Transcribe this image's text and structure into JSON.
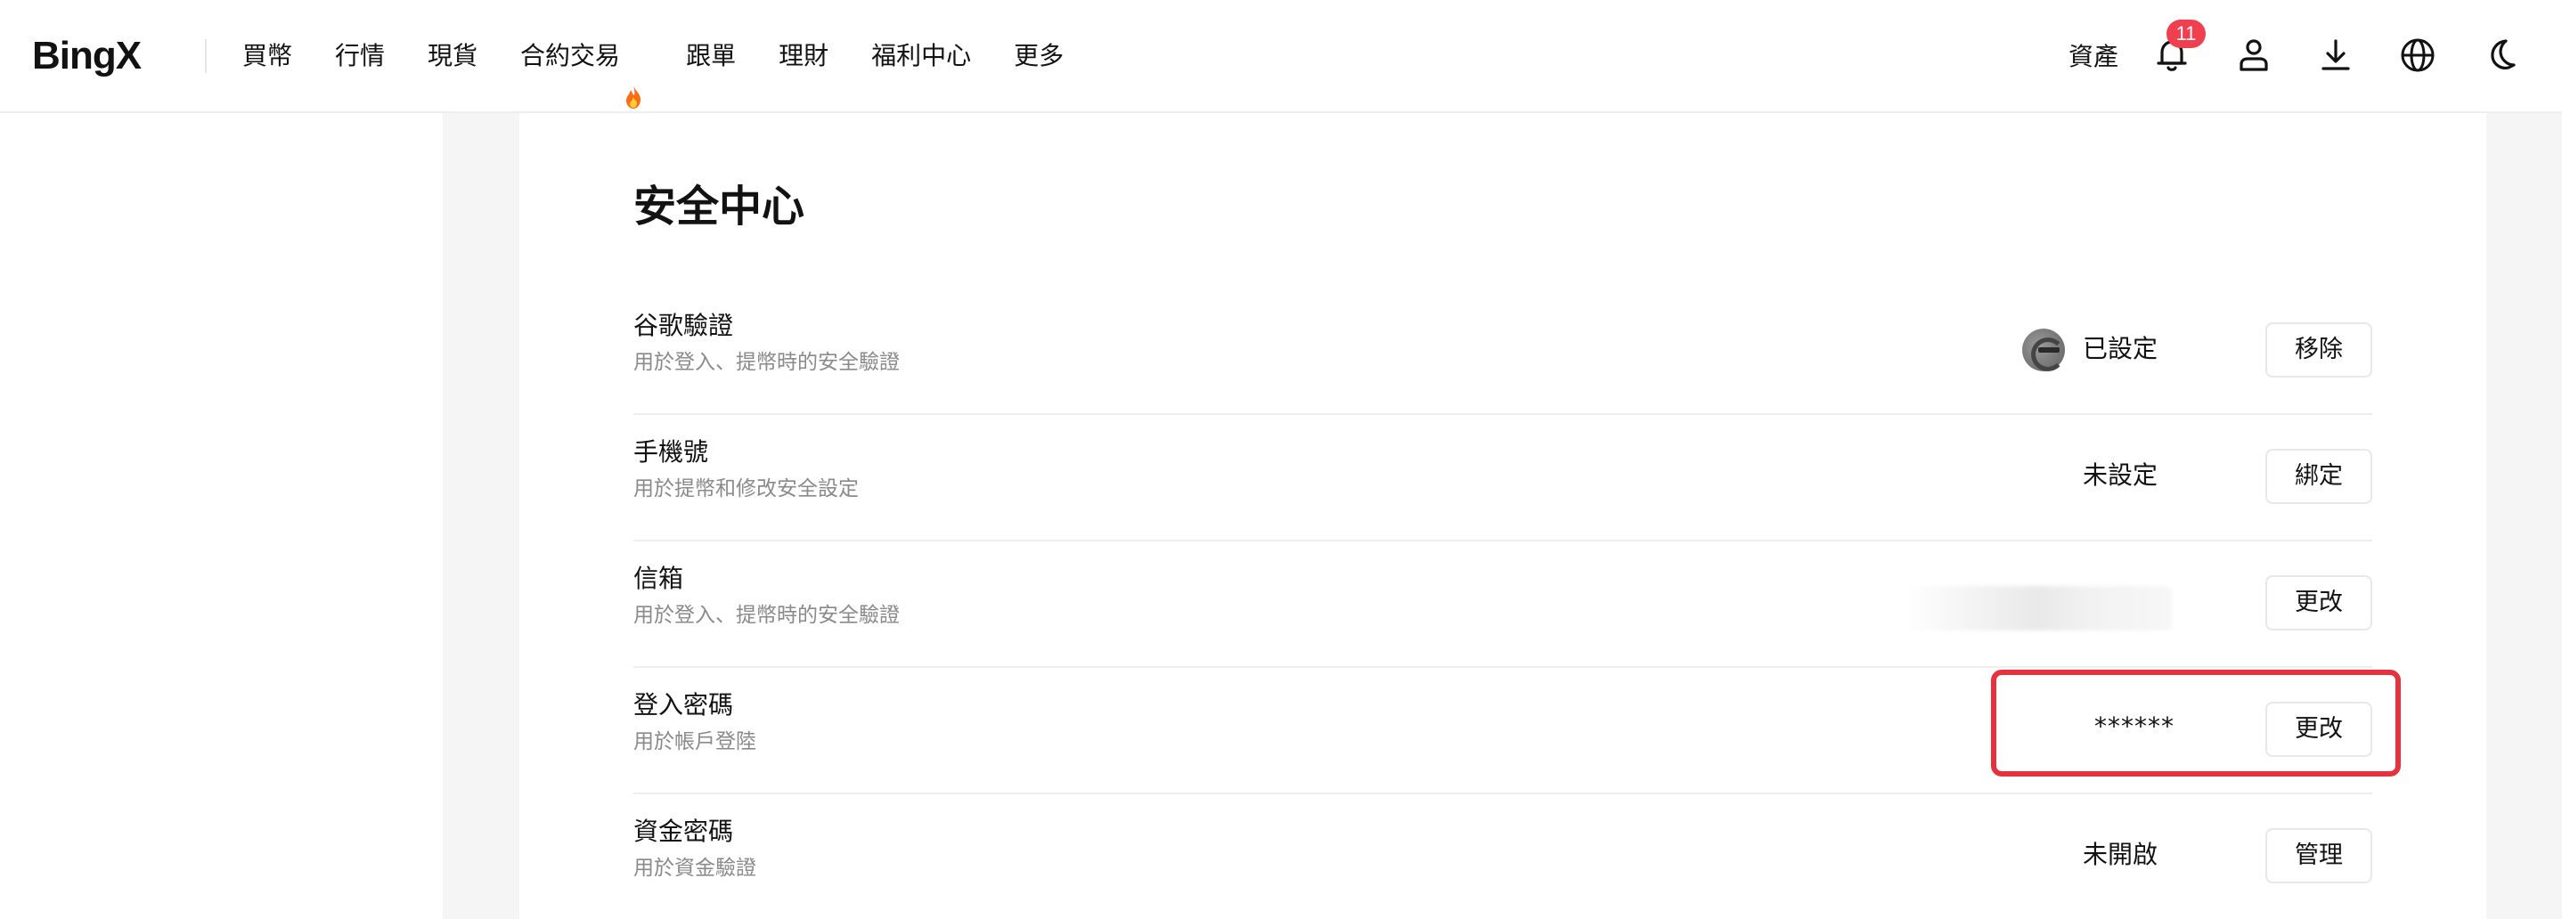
{
  "header": {
    "logo": "BingX",
    "nav": [
      {
        "label": "買幣"
      },
      {
        "label": "行情"
      },
      {
        "label": "現貨"
      },
      {
        "label": "合約交易"
      },
      {
        "label": "跟單"
      },
      {
        "label": "理財"
      },
      {
        "label": "福利中心"
      },
      {
        "label": "更多"
      }
    ],
    "assets_label": "資產",
    "notification_count": "11",
    "icons": [
      "bell-icon",
      "user-icon",
      "download-icon",
      "globe-icon",
      "moon-icon"
    ]
  },
  "page": {
    "title": "安全中心"
  },
  "security_items": [
    {
      "title": "谷歌驗證",
      "desc": "用於登入、提幣時的安全驗證",
      "status": "已設定",
      "action": "移除",
      "icon": "google-authenticator-icon"
    },
    {
      "title": "手機號",
      "desc": "用於提幣和修改安全設定",
      "status": "未設定",
      "action": "綁定"
    },
    {
      "title": "信箱",
      "desc": "用於登入、提幣時的安全驗證",
      "status": "",
      "action": "更改"
    },
    {
      "title": "登入密碼",
      "desc": "用於帳戶登陸",
      "status": "******",
      "action": "更改"
    },
    {
      "title": "資金密碼",
      "desc": "用於資金驗證",
      "status": "未開啟",
      "action": "管理"
    }
  ],
  "colors": {
    "highlight": "#e8313f",
    "badge": "#f0404f",
    "text": "#121212",
    "muted": "#8a8a8a"
  }
}
